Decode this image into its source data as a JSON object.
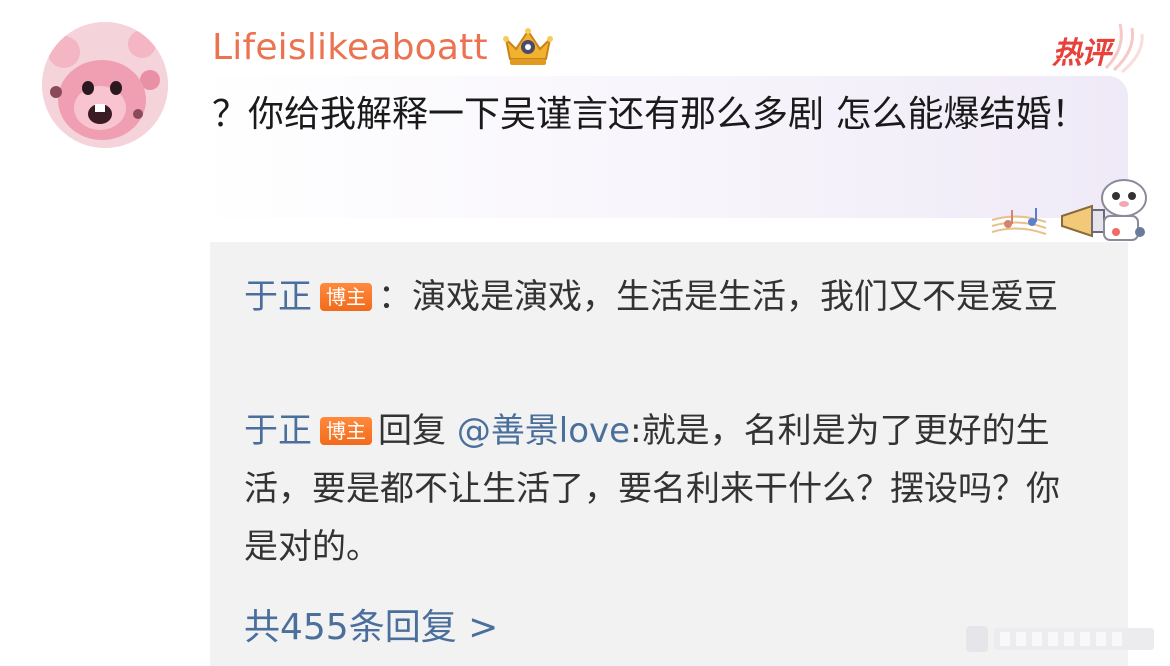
{
  "comment": {
    "username": "Lifeislikeaboatt",
    "hot_label": "热评",
    "text": "？你给我解释一下吴谨言还有那么多剧 怎么能爆结婚！"
  },
  "replies": [
    {
      "name": "于正",
      "tag": "博主",
      "separator": "：",
      "text": "演戏是演戏，生活是生活，我们又不是爱豆"
    },
    {
      "name": "于正",
      "tag": "博主",
      "reply_word": "回复",
      "mention": "@善景love",
      "text": ":就是，名利是为了更好的生活，要是都不让生活了，要名利来干什么？摆设吗？你是对的。"
    }
  ],
  "more_replies": "共455条回复 >",
  "colors": {
    "username": "#eb7350",
    "link": "#4b6f9c",
    "tag": "#f26a1b",
    "hot": "#e8403a",
    "reply_bg": "#f2f2f2"
  },
  "icons": [
    "avatar",
    "crown-icon",
    "hot-comment-icon",
    "music-deco-icon",
    "megaphone-deco-icon",
    "watermark"
  ]
}
